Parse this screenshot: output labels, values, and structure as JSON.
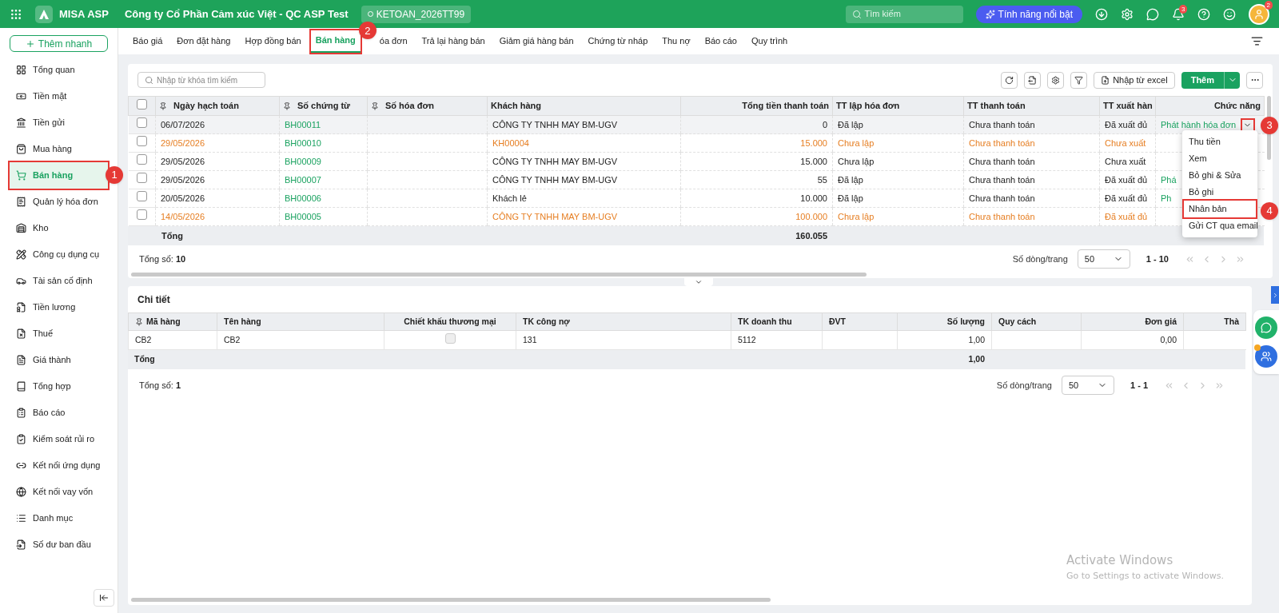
{
  "topbar": {
    "app_name": "MISA ASP",
    "company": "Công ty Cổ Phần Cảm xúc Việt - QC ASP Test",
    "database": "KETOAN_2026TT99",
    "search_placeholder": "Tìm kiếm",
    "feature_button": "Tính năng nổi bật",
    "notification_count": "3",
    "avatar_badge": "2"
  },
  "sidebar": {
    "quick_add": "Thêm nhanh",
    "items": [
      {
        "label": "Tổng quan",
        "selected": false
      },
      {
        "label": "Tiền mặt",
        "selected": false
      },
      {
        "label": "Tiền gửi",
        "selected": false
      },
      {
        "label": "Mua hàng",
        "selected": false
      },
      {
        "label": "Bán hàng",
        "selected": true,
        "callout": "1"
      },
      {
        "label": "Quản lý hóa đơn",
        "selected": false
      },
      {
        "label": "Kho",
        "selected": false
      },
      {
        "label": "Công cụ dụng cụ",
        "selected": false
      },
      {
        "label": "Tài sản cố định",
        "selected": false
      },
      {
        "label": "Tiền lương",
        "selected": false
      },
      {
        "label": "Thuế",
        "selected": false
      },
      {
        "label": "Giá thành",
        "selected": false
      },
      {
        "label": "Tổng hợp",
        "selected": false
      },
      {
        "label": "Báo cáo",
        "selected": false
      },
      {
        "label": "Kiểm soát rủi ro",
        "selected": false
      },
      {
        "label": "Kết nối ứng dụng",
        "selected": false
      },
      {
        "label": "Kết nối vay vốn",
        "selected": false
      },
      {
        "label": "Danh mục",
        "selected": false
      },
      {
        "label": "Số dư ban đầu",
        "selected": false
      }
    ]
  },
  "tabs": [
    {
      "label": "Báo giá",
      "selected": false
    },
    {
      "label": "Đơn đặt hàng",
      "selected": false
    },
    {
      "label": "Hợp đồng bán",
      "selected": false
    },
    {
      "label": "Bán hàng",
      "selected": true,
      "callout": "2"
    },
    {
      "label": "óa đơn",
      "selected": false
    },
    {
      "label": "Trả lại hàng bán",
      "selected": false
    },
    {
      "label": "Giảm giá hàng bán",
      "selected": false
    },
    {
      "label": "Chứng từ nháp",
      "selected": false
    },
    {
      "label": "Thu nợ",
      "selected": false
    },
    {
      "label": "Báo cáo",
      "selected": false
    },
    {
      "label": "Quy trình",
      "selected": false
    }
  ],
  "toolbar": {
    "search_placeholder": "Nhập từ khóa tìm kiếm",
    "import_button": "Nhập từ excel",
    "add_button": "Thêm"
  },
  "table": {
    "all_checked": false,
    "columns": [
      {
        "label": "Ngày hạch toán",
        "pinned": true
      },
      {
        "label": "Số chứng từ",
        "pinned": true
      },
      {
        "label": "Số hóa đơn",
        "pinned": true
      },
      {
        "label": "Khách hàng",
        "pinned": false
      },
      {
        "label": "Tổng tiền thanh toán",
        "pinned": false
      },
      {
        "label": "TT lập hóa đơn",
        "pinned": false
      },
      {
        "label": "TT thanh toán",
        "pinned": false
      },
      {
        "label": "TT xuất hàn",
        "pinned": false
      },
      {
        "label": "Chức năng",
        "pinned": false
      }
    ],
    "rows": [
      {
        "selected": true,
        "checked": false,
        "warning": false,
        "cells": [
          "06/07/2026",
          "BH00011",
          "",
          "CÔNG TY TNHH MAY BM-UGV",
          "0",
          "Đã lập",
          "Chưa thanh toán",
          "Đã xuất đủ"
        ],
        "action": "Phát hành hóa đơn",
        "action_callout": "3"
      },
      {
        "selected": false,
        "checked": false,
        "warning": true,
        "cells": [
          "29/05/2026",
          "BH00010",
          "",
          "KH00004",
          "15.000",
          "Chưa lập",
          "Chưa thanh toán",
          "Chưa xuất"
        ]
      },
      {
        "selected": false,
        "checked": false,
        "warning": false,
        "cells": [
          "29/05/2026",
          "BH00009",
          "",
          "CÔNG TY TNHH MAY BM-UGV",
          "15.000",
          "Chưa lập",
          "Chưa thanh toán",
          "Chưa xuất"
        ]
      },
      {
        "selected": false,
        "checked": false,
        "warning": false,
        "cells": [
          "29/05/2026",
          "BH00007",
          "",
          "CÔNG TY TNHH MAY BM-UGV",
          "55",
          "Đã lập",
          "Chưa thanh toán",
          "Đã xuất đủ"
        ],
        "action": "Phá"
      },
      {
        "selected": false,
        "checked": false,
        "warning": false,
        "cells": [
          "20/05/2026",
          "BH00006",
          "",
          "Khách lẻ",
          "10.000",
          "Đã lập",
          "Chưa thanh toán",
          "Đã xuất đủ"
        ],
        "action": "Ph"
      },
      {
        "selected": false,
        "checked": false,
        "warning": true,
        "cells": [
          "14/05/2026",
          "BH00005",
          "",
          "CÔNG TY TNHH MAY BM-UGV",
          "100.000",
          "Chưa lập",
          "Chưa thanh toán",
          "Đã xuất đủ"
        ]
      }
    ],
    "total_label": "Tổng",
    "total_amount": "160.055",
    "count_label": "Tổng số:",
    "count": "10",
    "page_size_label": "Số dòng/trang",
    "page_size": "50",
    "range": "1 - 10"
  },
  "action_menu": [
    {
      "label": "Thu tiền"
    },
    {
      "label": "Xem"
    },
    {
      "label": "Bỏ ghi & Sửa"
    },
    {
      "label": "Bỏ ghi"
    },
    {
      "label": "Nhân bản",
      "callout": "4"
    },
    {
      "label": "Gửi CT qua email"
    }
  ],
  "detail": {
    "title": "Chi tiết",
    "columns": [
      {
        "label": "Mã hàng",
        "pinned": true
      },
      {
        "label": "Tên hàng",
        "pinned": false
      },
      {
        "label": "Chiết khấu thương mại",
        "pinned": false
      },
      {
        "label": "TK công nợ",
        "pinned": false
      },
      {
        "label": "TK doanh thu",
        "pinned": false
      },
      {
        "label": "ĐVT",
        "pinned": false
      },
      {
        "label": "Số lượng",
        "pinned": false
      },
      {
        "label": "Quy cách",
        "pinned": false
      },
      {
        "label": "Đơn giá",
        "pinned": false
      },
      {
        "label": "Thà",
        "pinned": false
      }
    ],
    "rows": [
      {
        "cells": [
          "CB2",
          "CB2",
          "",
          "131",
          "5112",
          "",
          "1,00",
          "",
          "0,00",
          ""
        ],
        "discount_checked": false
      }
    ],
    "total_label": "Tổng",
    "total_quantity": "1,00",
    "count_label": "Tổng số:",
    "count": "1",
    "page_size_label": "Số dòng/trang",
    "page_size": "50",
    "range": "1 - 1"
  },
  "os_notice": {
    "title": "Activate Windows",
    "text": "Go to Settings to activate Windows."
  }
}
